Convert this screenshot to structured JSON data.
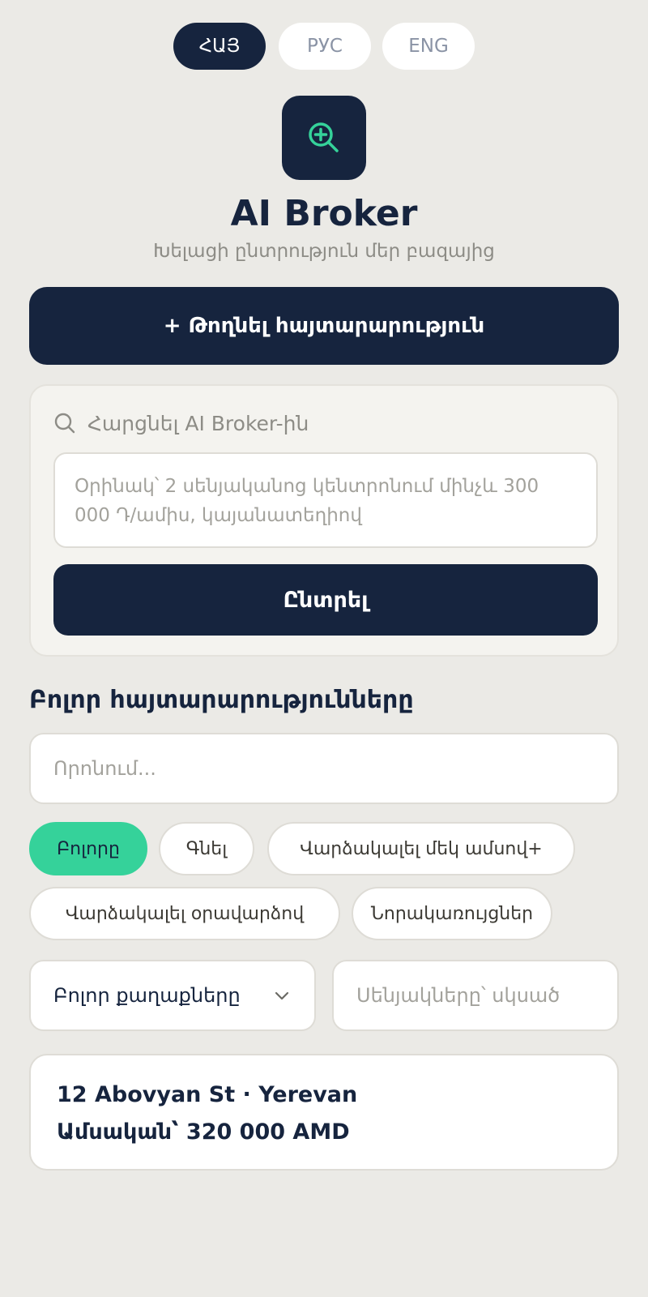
{
  "languages": [
    {
      "label": "ՀԱՅ",
      "active": true
    },
    {
      "label": "РУС",
      "active": false
    },
    {
      "label": "ENG",
      "active": false
    }
  ],
  "app": {
    "logo_icon": "search-plus-icon",
    "title": "AI Broker",
    "subtitle": "Խելացի ընտրություն մեր բազայից"
  },
  "post_button_label": "+ Թողնել հայտարարություն",
  "ai_search": {
    "icon": "search-icon",
    "label": "Հարցնել AI Broker-ին",
    "placeholder": "Օրինակ՝ 2 սենյականոց կենտրոնում մինչև 300 000 Դ/ամիս, կայանատեղիով",
    "button_label": "Ընտրել"
  },
  "listings_section": {
    "title": "Բոլոր հայտարարությունները",
    "search_placeholder": "Որոնում...",
    "filter_chips": [
      {
        "label": "Բոլորը",
        "active": true
      },
      {
        "label": "Գնել",
        "active": false
      },
      {
        "label": "Վարձակալել մեկ ամսով+",
        "active": false
      },
      {
        "label": "Վարձակալել օրավարձով",
        "active": false
      },
      {
        "label": "Նորակառույցներ",
        "active": false
      }
    ],
    "city_select": {
      "value": "Բոլոր քաղաքները",
      "icon": "chevron-down-icon"
    },
    "rooms_placeholder": "Սենյակները՝ սկսած"
  },
  "listings": [
    {
      "address": "12 Abovyan St · Yerevan",
      "price": "Ամսական՝ 320 000 AMD"
    }
  ],
  "colors": {
    "primary": "#16243e",
    "accent": "#35d29a",
    "background": "#ebeae6",
    "muted_text": "#8d8c86"
  }
}
